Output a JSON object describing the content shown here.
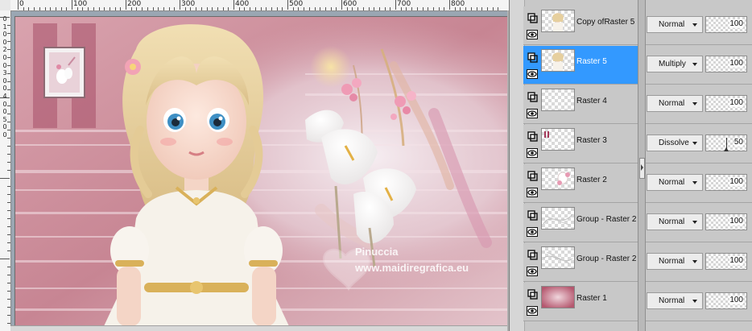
{
  "ruler": {
    "h_labels": [
      "0",
      "100",
      "200",
      "300",
      "400",
      "500",
      "600",
      "700",
      "800"
    ],
    "v_labels": [
      "0",
      "1",
      "0",
      "0",
      "2",
      "0",
      "0",
      "3",
      "0",
      "0",
      "4",
      "0",
      "0",
      "5",
      "0",
      "0"
    ]
  },
  "watermark": {
    "line1": "Pinuccia",
    "line2": "www.maidiregrafica.eu"
  },
  "layers": [
    {
      "name": "Copy ofRaster 5",
      "blend": "Normal",
      "opacity": "100",
      "selected": false,
      "thumb": "girl"
    },
    {
      "name": "Raster 5",
      "blend": "Multiply",
      "opacity": "100",
      "selected": true,
      "thumb": "girl"
    },
    {
      "name": "Raster 4",
      "blend": "Normal",
      "opacity": "100",
      "selected": false,
      "thumb": "empty"
    },
    {
      "name": "Raster 3",
      "blend": "Dissolve",
      "opacity": "50",
      "selected": false,
      "thumb": "mark"
    },
    {
      "name": "Raster 2",
      "blend": "Normal",
      "opacity": "100",
      "selected": false,
      "thumb": "flowers"
    },
    {
      "name": "Group - Raster 2",
      "blend": "Normal",
      "opacity": "100",
      "selected": false,
      "thumb": "lines"
    },
    {
      "name": "Group - Raster 2",
      "blend": "Normal",
      "opacity": "100",
      "selected": false,
      "thumb": "lines2"
    },
    {
      "name": "Raster 1",
      "blend": "Normal",
      "opacity": "100",
      "selected": false,
      "thumb": "pink"
    }
  ],
  "icons": {
    "layer_link": "layer-link-icon",
    "visibility": "eye-icon",
    "dropdown": "chevron-down-icon",
    "splitter": "collapse-arrow-icon"
  },
  "colors": {
    "selected": "#3399ff",
    "panel": "#c8c8c8",
    "canvas_pink": "#c57f8e"
  }
}
